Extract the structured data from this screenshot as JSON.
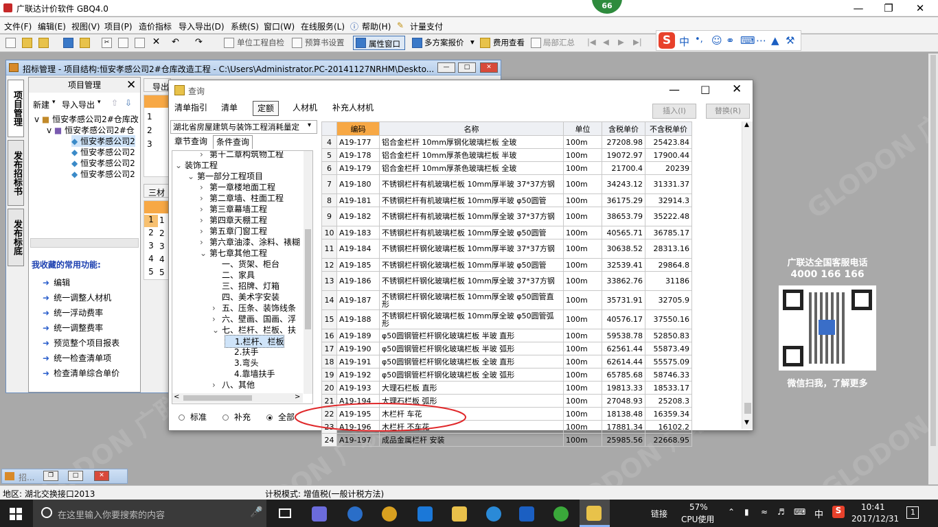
{
  "app": {
    "title": "广联达计价软件 GBQ4.0",
    "badge": "66"
  },
  "menu": [
    "文件(F)",
    "编辑(E)",
    "视图(V)",
    "项目(P)",
    "造价指标",
    "导入导出(D)",
    "系统(S)",
    "窗口(W)",
    "在线服务(L)",
    "帮助(H)",
    "计量支付"
  ],
  "toolbar": {
    "self_check": "单位工程自检",
    "budget_settings": "预算书设置",
    "property_window": "属性窗口",
    "multi_quote": "多方案报价",
    "fee_view": "费用查看",
    "local_summary": "局部汇总"
  },
  "ime": {
    "brand": "S",
    "lang": "中",
    "punct": "•,"
  },
  "mdi": {
    "title": "招标管理 - 项目结构:恒安孝感公司2#仓库改造工程 - C:\\Users\\Administrator.PC-20141127NRHM\\Deskto...",
    "vtabs": [
      "项目管理",
      "发布招标书",
      "发布标底"
    ],
    "proj_header": "项目管理",
    "new_label": "新建",
    "import_label": "导入导出",
    "tree": [
      "恒安孝感公司2#仓库改",
      "恒安孝感公司2#仓",
      "恒安孝感公司2",
      "恒安孝感公司2",
      "恒安孝感公司2",
      "恒安孝感公司2"
    ],
    "fav_title": "我收藏的常用功能:",
    "fav": [
      "编辑",
      "统一调整人材机",
      "统一浮动费率",
      "统一调整费率",
      "预览整个项目报表",
      "统一检查清单项",
      "检查清单综合单价"
    ],
    "export_label": "导出",
    "section_label": "三材",
    "grid_rows": [
      "1",
      "2",
      "3",
      "4",
      "5"
    ]
  },
  "dialog": {
    "title": "查询",
    "tabs": [
      "清单指引",
      "清单",
      "定额",
      "人材机",
      "补充人材机"
    ],
    "insert_btn": "插入(I)",
    "replace_btn": "替换(R)",
    "quota_select": "湖北省房屋建筑与装饰工程消耗量定",
    "subtabs": [
      "章节查询",
      "条件查询"
    ],
    "tree": [
      {
        "t": "第十二章构筑物工程",
        "lvl": 2,
        "exp": ">"
      },
      {
        "t": "装饰工程",
        "lvl": 0,
        "exp": "v"
      },
      {
        "t": "第一部分工程项目",
        "lvl": 1,
        "exp": "v"
      },
      {
        "t": "第一章楼地面工程",
        "lvl": 2,
        "exp": ">"
      },
      {
        "t": "第二章墙、柱面工程",
        "lvl": 2,
        "exp": ">"
      },
      {
        "t": "第三章幕墙工程",
        "lvl": 2,
        "exp": ">"
      },
      {
        "t": "第四章天棚工程",
        "lvl": 2,
        "exp": ">"
      },
      {
        "t": "第五章门窗工程",
        "lvl": 2,
        "exp": ">"
      },
      {
        "t": "第六章油漆、涂料、裱糊",
        "lvl": 2,
        "exp": ">"
      },
      {
        "t": "第七章其他工程",
        "lvl": 2,
        "exp": "v"
      },
      {
        "t": "一、货架、柜台",
        "lvl": 3,
        "exp": ""
      },
      {
        "t": "二、家具",
        "lvl": 3,
        "exp": ""
      },
      {
        "t": "三、招牌、灯箱",
        "lvl": 3,
        "exp": ""
      },
      {
        "t": "四、美术字安装",
        "lvl": 3,
        "exp": ""
      },
      {
        "t": "五、压条、装饰线条",
        "lvl": 3,
        "exp": ">"
      },
      {
        "t": "六、壁画、国画、浮",
        "lvl": 3,
        "exp": ">"
      },
      {
        "t": "七、栏杆、栏板、扶",
        "lvl": 3,
        "exp": "v"
      },
      {
        "t": "1.栏杆、栏板",
        "lvl": 4,
        "exp": "",
        "sel": true
      },
      {
        "t": "2.扶手",
        "lvl": 4,
        "exp": ""
      },
      {
        "t": "3.弯头",
        "lvl": 4,
        "exp": ""
      },
      {
        "t": "4.靠墙扶手",
        "lvl": 4,
        "exp": ""
      },
      {
        "t": "八、其他",
        "lvl": 3,
        "exp": ">"
      }
    ],
    "radios": [
      "标准",
      "补充",
      "全部"
    ],
    "columns": [
      "编码",
      "名称",
      "单位",
      "含税单价",
      "不含税单价"
    ],
    "rows": [
      [
        "4",
        "A19-177",
        "铝合金栏杆 10mm厚钢化玻璃栏板 全玻",
        "100m",
        "27208.98",
        "25423.84"
      ],
      [
        "5",
        "A19-178",
        "铝合金栏杆 10mm厚茶色玻璃栏板 半玻",
        "100m",
        "19072.97",
        "17900.44"
      ],
      [
        "6",
        "A19-179",
        "铝合金栏杆 10mm厚茶色玻璃栏板 全玻",
        "100m",
        "21700.4",
        "20239"
      ],
      [
        "7",
        "A19-180",
        "不锈钢栏杆有机玻璃栏板 10mm厚半玻 37*37方钢",
        "100m",
        "34243.12",
        "31331.37"
      ],
      [
        "8",
        "A19-181",
        "不锈钢栏杆有机玻璃栏板 10mm厚半玻 φ50圆管",
        "100m",
        "36175.29",
        "32914.3"
      ],
      [
        "9",
        "A19-182",
        "不锈钢栏杆有机玻璃栏板 10mm厚全玻 37*37方钢",
        "100m",
        "38653.79",
        "35222.48"
      ],
      [
        "10",
        "A19-183",
        "不锈钢栏杆有机玻璃栏板 10mm厚全玻 φ50圆管",
        "100m",
        "40565.71",
        "36785.17"
      ],
      [
        "11",
        "A19-184",
        "不锈钢栏杆钢化玻璃栏板 10mm厚半玻 37*37方钢",
        "100m",
        "30638.52",
        "28313.16"
      ],
      [
        "12",
        "A19-185",
        "不锈钢栏杆钢化玻璃栏板 10mm厚半玻 φ50圆管",
        "100m",
        "32539.41",
        "29864.8"
      ],
      [
        "13",
        "A19-186",
        "不锈钢栏杆钢化玻璃栏板 10mm厚全玻 37*37方钢",
        "100m",
        "33862.76",
        "31186"
      ],
      [
        "14",
        "A19-187",
        "不锈钢栏杆钢化玻璃栏板 10mm厚全玻 φ50圆管直形",
        "100m",
        "35731.91",
        "32705.9"
      ],
      [
        "15",
        "A19-188",
        "不锈钢栏杆钢化玻璃栏板 10mm厚全玻 φ50圆管弧形",
        "100m",
        "40576.17",
        "37550.16"
      ],
      [
        "16",
        "A19-189",
        "φ50圆钢管栏杆钢化玻璃栏板 半玻 直形",
        "100m",
        "59538.78",
        "52850.83"
      ],
      [
        "17",
        "A19-190",
        "φ50圆钢管栏杆钢化玻璃栏板 半玻 弧形",
        "100m",
        "62561.44",
        "55873.49"
      ],
      [
        "18",
        "A19-191",
        "φ50圆钢管栏杆钢化玻璃栏板 全玻 直形",
        "100m",
        "62614.44",
        "55575.09"
      ],
      [
        "19",
        "A19-192",
        "φ50圆钢管栏杆钢化玻璃栏板 全玻 弧形",
        "100m",
        "65785.68",
        "58746.33"
      ],
      [
        "20",
        "A19-193",
        "大理石栏板 直形",
        "100m",
        "19813.33",
        "18533.17"
      ],
      [
        "21",
        "A19-194",
        "大理石栏板 弧形",
        "100m",
        "27048.93",
        "25208.3"
      ],
      [
        "22",
        "A19-195",
        "木栏杆 车花",
        "100m",
        "18138.48",
        "16359.34"
      ],
      [
        "23",
        "A19-196",
        "木栏杆 不车花",
        "100m",
        "17881.34",
        "16102.2"
      ],
      [
        "24",
        "A19-197",
        "成品金属栏杆 安装",
        "100m",
        "25985.56",
        "22668.95"
      ]
    ]
  },
  "promo": {
    "line1": "广联达全国客服电话",
    "phone": "4000 166 166",
    "line3": "微信扫我，了解更多"
  },
  "watermark": "GLODON 广联达",
  "minimized": "招...",
  "status": {
    "region": "地区: 湖北交换接口2013",
    "tax_mode": "计税模式: 增值税(一般计税方法)"
  },
  "taskbar": {
    "search": "在这里输入你要搜索的内容",
    "link": "链接",
    "cpu_pct": "57%",
    "cpu_label": "CPU使用",
    "lang": "中",
    "time": "10:41",
    "date": "2017/12/31",
    "notif": "1"
  }
}
